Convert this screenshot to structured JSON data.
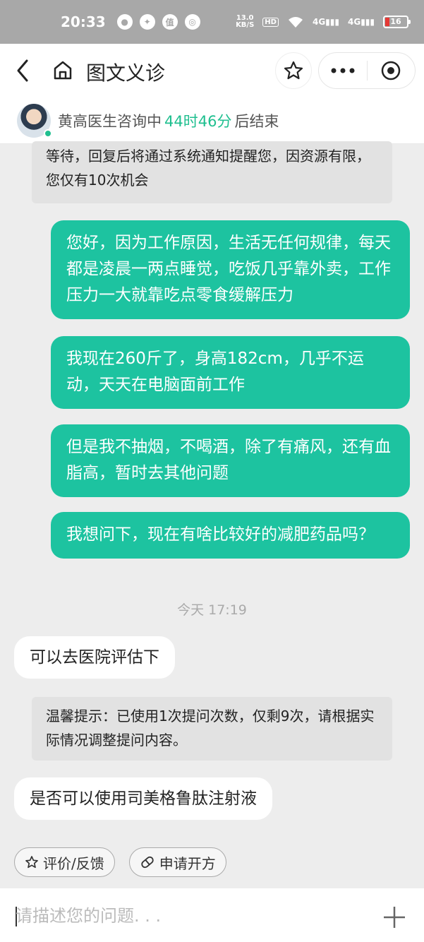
{
  "status_bar": {
    "time": "20:33",
    "speed_top": "13.0",
    "speed_unit": "KB/S",
    "hd": "HD",
    "net1": "4G",
    "net2": "4G",
    "battery": "16"
  },
  "nav": {
    "title": "图文义诊"
  },
  "doctor_bar": {
    "prefix": "黄高医生咨询中",
    "countdown": "44时46分",
    "suffix": "后结束"
  },
  "messages": {
    "sys_top": "等待，回复后将通过系统通知提醒您，因资源有限，您仅有10次机会",
    "me1": "您好，因为工作原因，生活无任何规律，每天都是凌晨一两点睡觉，吃饭几乎靠外卖，工作压力一大就靠吃点零食缓解压力",
    "me2": "我现在260斤了，身高182cm，几乎不运动，天天在电脑面前工作",
    "me3": "但是我不抽烟，不喝酒，除了有痛风，还有血脂高，暂时去其他问题",
    "me4": "我想问下，现在有啥比较好的减肥药品吗？",
    "timestamp": "今天 17:19",
    "doc1": "可以去医院评估下",
    "sys_tip": "温馨提示：已使用1次提问次数，仅剩9次，请根据实际情况调整提问内容。",
    "doc2": "是否可以使用司美格鲁肽注射液"
  },
  "chips": {
    "feedback": "评价/反馈",
    "prescription": "申请开方"
  },
  "input": {
    "placeholder": "请描述您的问题. . ."
  },
  "colors": {
    "accent": "#1dc3a0",
    "countdown": "#1fbf8f"
  }
}
